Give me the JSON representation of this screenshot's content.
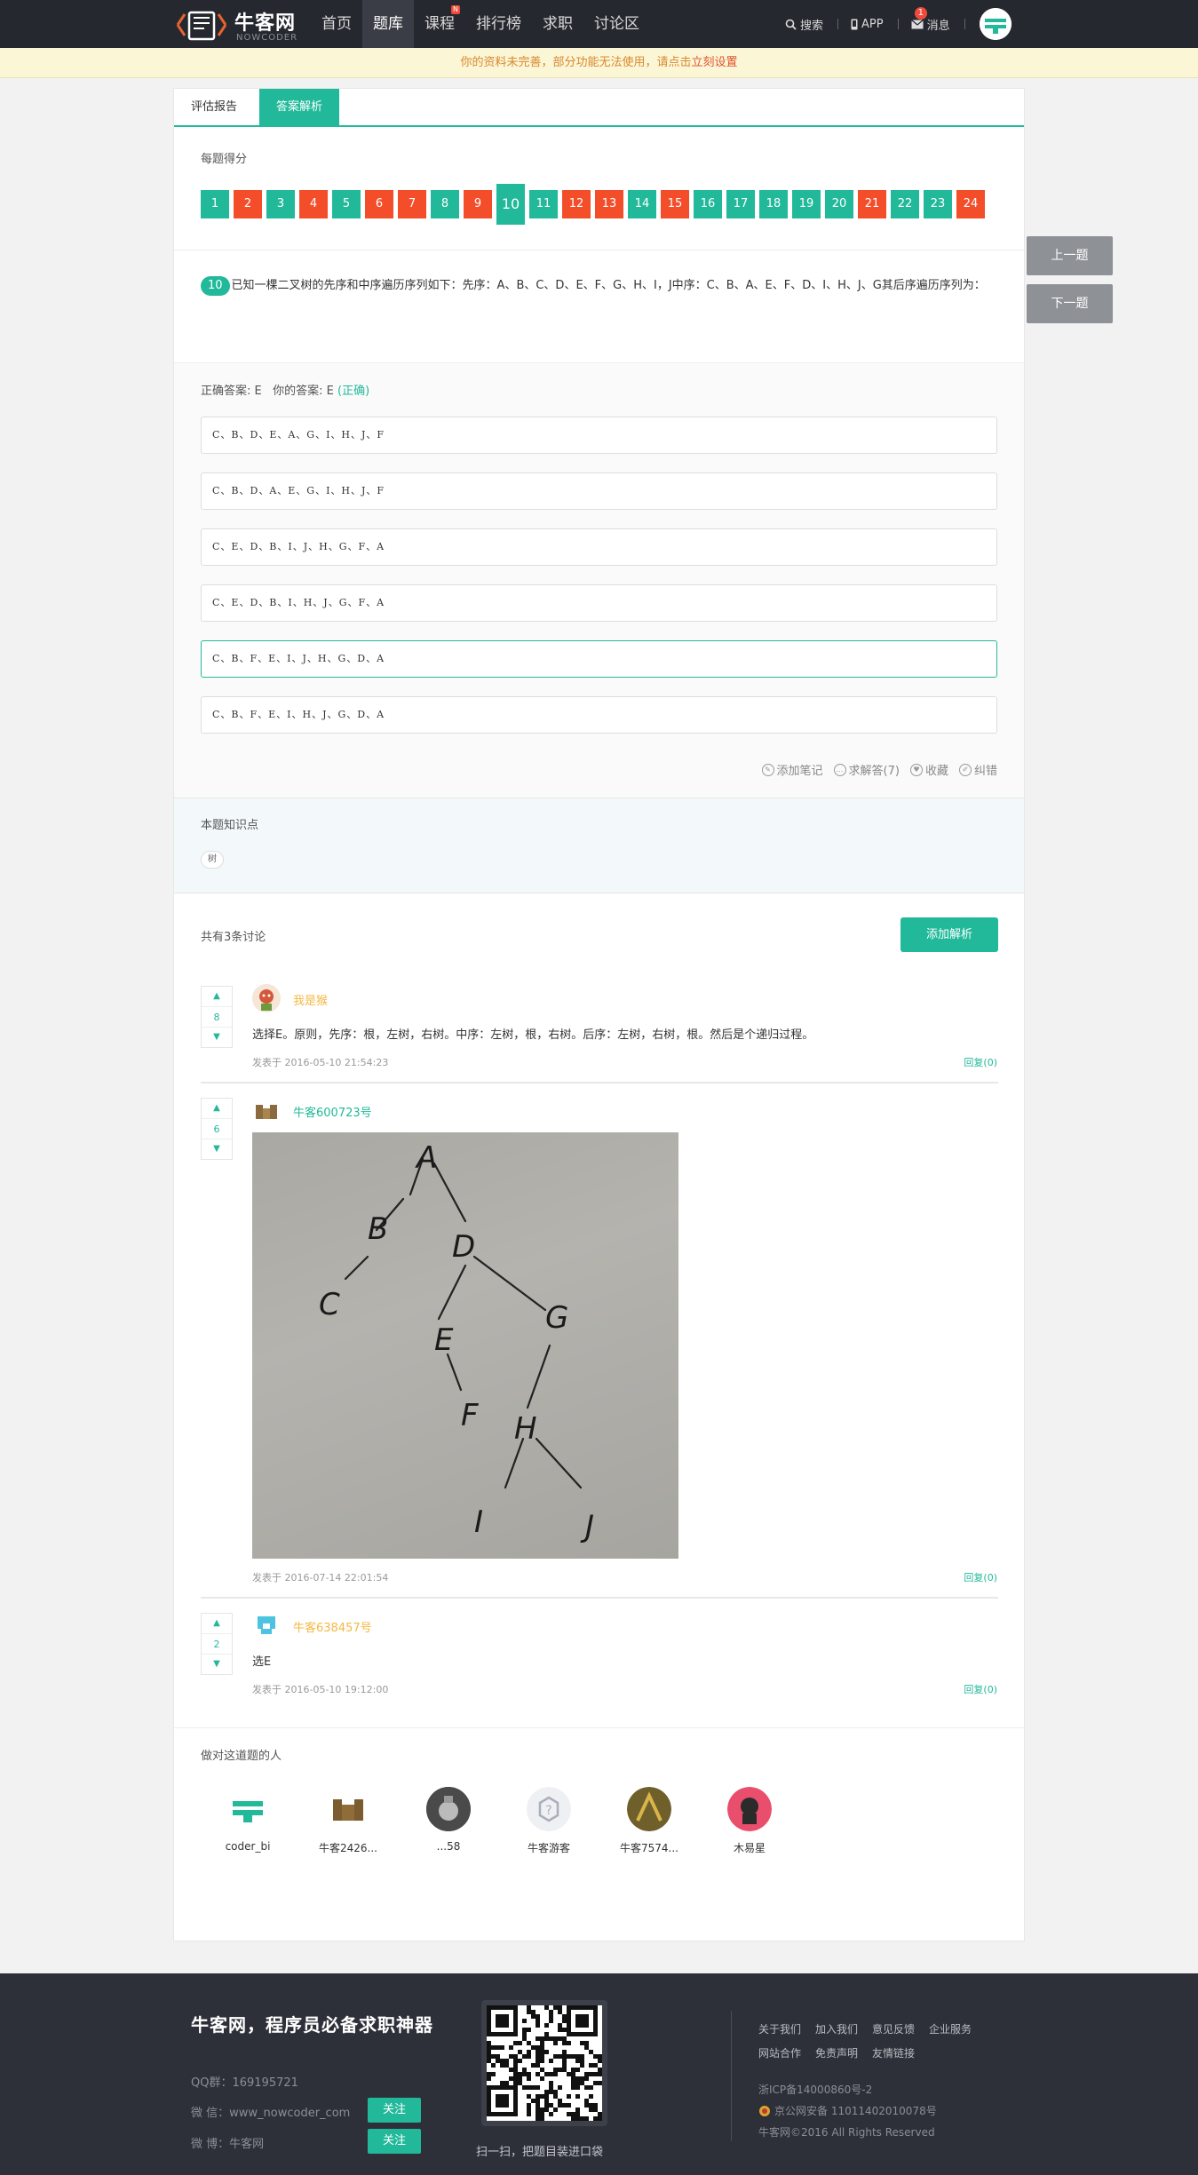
{
  "header": {
    "logo_text": "牛客网",
    "logo_sub": "NOWCODER",
    "nav": [
      {
        "label": "首页"
      },
      {
        "label": "题库"
      },
      {
        "label": "课程",
        "badge": "N"
      },
      {
        "label": "排行榜"
      },
      {
        "label": "求职"
      },
      {
        "label": "讨论区"
      }
    ],
    "search_label": "搜索",
    "app_label": "APP",
    "messages_label": "消息",
    "messages_count": "1"
  },
  "notice": {
    "text": "你的资料未完善，部分功能无法使用，请点击",
    "link": "立刻设置"
  },
  "tabs": [
    {
      "label": "评估报告"
    },
    {
      "label": "答案解析"
    }
  ],
  "score_section": {
    "title": "每题得分",
    "current": "10",
    "items": [
      {
        "n": "1",
        "status": "green"
      },
      {
        "n": "2",
        "status": "red"
      },
      {
        "n": "3",
        "status": "green"
      },
      {
        "n": "4",
        "status": "red"
      },
      {
        "n": "5",
        "status": "green"
      },
      {
        "n": "6",
        "status": "red"
      },
      {
        "n": "7",
        "status": "red"
      },
      {
        "n": "8",
        "status": "green"
      },
      {
        "n": "9",
        "status": "red"
      },
      {
        "n": "10",
        "status": "green"
      },
      {
        "n": "11",
        "status": "green"
      },
      {
        "n": "12",
        "status": "red"
      },
      {
        "n": "13",
        "status": "red"
      },
      {
        "n": "14",
        "status": "green"
      },
      {
        "n": "15",
        "status": "red"
      },
      {
        "n": "16",
        "status": "green"
      },
      {
        "n": "17",
        "status": "green"
      },
      {
        "n": "18",
        "status": "green"
      },
      {
        "n": "19",
        "status": "green"
      },
      {
        "n": "20",
        "status": "green"
      },
      {
        "n": "21",
        "status": "red"
      },
      {
        "n": "22",
        "status": "green"
      },
      {
        "n": "23",
        "status": "green"
      },
      {
        "n": "24",
        "status": "red"
      }
    ]
  },
  "question": {
    "number": "10",
    "text": "已知一棵二叉树的先序和中序遍历序列如下：先序：A、B、C、D、E、F、G、H、I，J中序：C、B、A、E、F、D、I、H、J、G其后序遍历序列为："
  },
  "answer": {
    "correct_label": "正确答案: E",
    "your_label": "你的答案: E",
    "status": "(正确)"
  },
  "options": [
    "C、B、D、E、A、G、I、H、J、F",
    "C、B、D、A、E、G、I、H、J、F",
    "C、E、D、B、I、J、H、G、F、A",
    "C、E、D、B、I、H、J、G、F、A",
    "C、B、F、E、I、J、H、G、D、A",
    "C、B、F、E、I、H、J、G、D、A"
  ],
  "actions": {
    "note": "添加笔记",
    "ask": "求解答(7)",
    "fav": "收藏",
    "report": "纠错"
  },
  "knowledge": {
    "title": "本题知识点",
    "tag": "树"
  },
  "discussion": {
    "count_text": "共有3条讨论",
    "add_button": "添加解析",
    "comments": [
      {
        "votes": "8",
        "user": "我是猴",
        "text": "选择E。原则，先序：根，左树，右树。中序：左树，根，右树。后序：左树，右树，根。然后是个递归过程。",
        "time": "发表于 2016-05-10 21:54:23",
        "reply": "回复(0)"
      },
      {
        "votes": "6",
        "user": "牛客600723号",
        "text": "",
        "time": "发表于 2016-07-14 22:01:54",
        "reply": "回复(0)"
      },
      {
        "votes": "2",
        "user": "牛客638457号",
        "text": "选E",
        "time": "发表于 2016-05-10 19:12:00",
        "reply": "回复(0)"
      }
    ]
  },
  "photo_letters": [
    "A",
    "B",
    "C",
    "D",
    "E",
    "G",
    "F",
    "H",
    "I",
    "J"
  ],
  "solvers": {
    "title": "做对这道题的人",
    "users": [
      "coder_bi",
      "牛客2426...",
      "...58",
      "牛客游客",
      "牛客7574...",
      "木易星"
    ]
  },
  "side": {
    "prev": "上一题",
    "next": "下一题"
  },
  "footer": {
    "slogan": "牛客网，程序员必备求职神器",
    "qq": "QQ群：169195721",
    "wechat": "微 信：www_nowcoder_com",
    "weibo": "微 博：牛客网",
    "follow": "关注",
    "qr_caption": "扫一扫，把题目装进口袋",
    "links": [
      "关于我们",
      "加入我们",
      "意见反馈",
      "企业服务",
      "网站合作",
      "免责声明",
      "友情链接"
    ],
    "icp": "浙ICP备14000860号-2",
    "police": "京公网安备 11011402010078号",
    "copyright": "牛客网©2016 All Rights Reserved"
  },
  "colors": {
    "accent": "#22b99a",
    "wrong": "#f34d2a",
    "nav_bg": "#26282f",
    "footer_bg": "#2d3038",
    "notice_bg": "#fbf6d6"
  }
}
